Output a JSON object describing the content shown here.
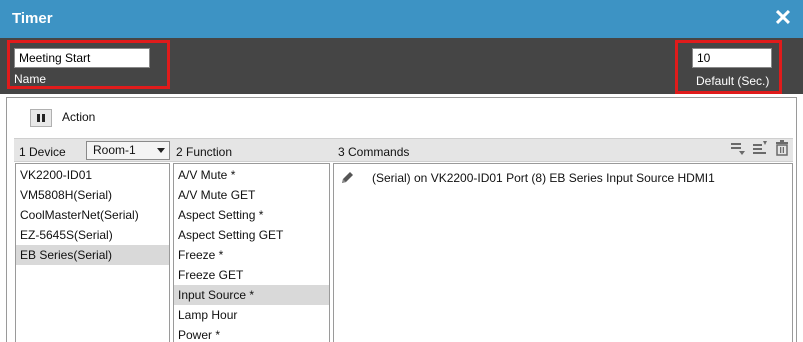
{
  "window": {
    "title": "Timer"
  },
  "header": {
    "name_value": "Meeting Start",
    "name_label": "Name",
    "default_value": "10",
    "default_label": "Default (Sec.)"
  },
  "action": {
    "label": "Action"
  },
  "columns": {
    "device": "1  Device",
    "room_selected": "Room-1",
    "function": "2  Function",
    "commands": "3  Commands"
  },
  "devices": [
    {
      "label": "VK2200-ID01"
    },
    {
      "label": "VM5808H(Serial)"
    },
    {
      "label": "CoolMasterNet(Serial)"
    },
    {
      "label": "EZ-5645S(Serial)"
    },
    {
      "label": "EB Series(Serial)"
    }
  ],
  "functions": [
    {
      "label": "A/V Mute *"
    },
    {
      "label": "A/V Mute GET"
    },
    {
      "label": "Aspect Setting *"
    },
    {
      "label": "Aspect Setting GET"
    },
    {
      "label": "Freeze *"
    },
    {
      "label": "Freeze GET"
    },
    {
      "label": "Input Source *"
    },
    {
      "label": "Lamp Hour"
    },
    {
      "label": "Power *"
    }
  ],
  "commands": [
    {
      "label": "(Serial) on VK2200-ID01 Port (8) EB Series Input Source  HDMI1"
    }
  ],
  "colors": {
    "titlebar": "#3d93c4",
    "header_band": "#454545",
    "highlight_box": "#e01b1b",
    "selected_row": "#d9d9d9"
  },
  "icons": [
    "close-icon",
    "pause-icon",
    "chevron-down-icon",
    "move-down-icon",
    "edit-list-icon",
    "trash-icon",
    "pencil-icon"
  ]
}
